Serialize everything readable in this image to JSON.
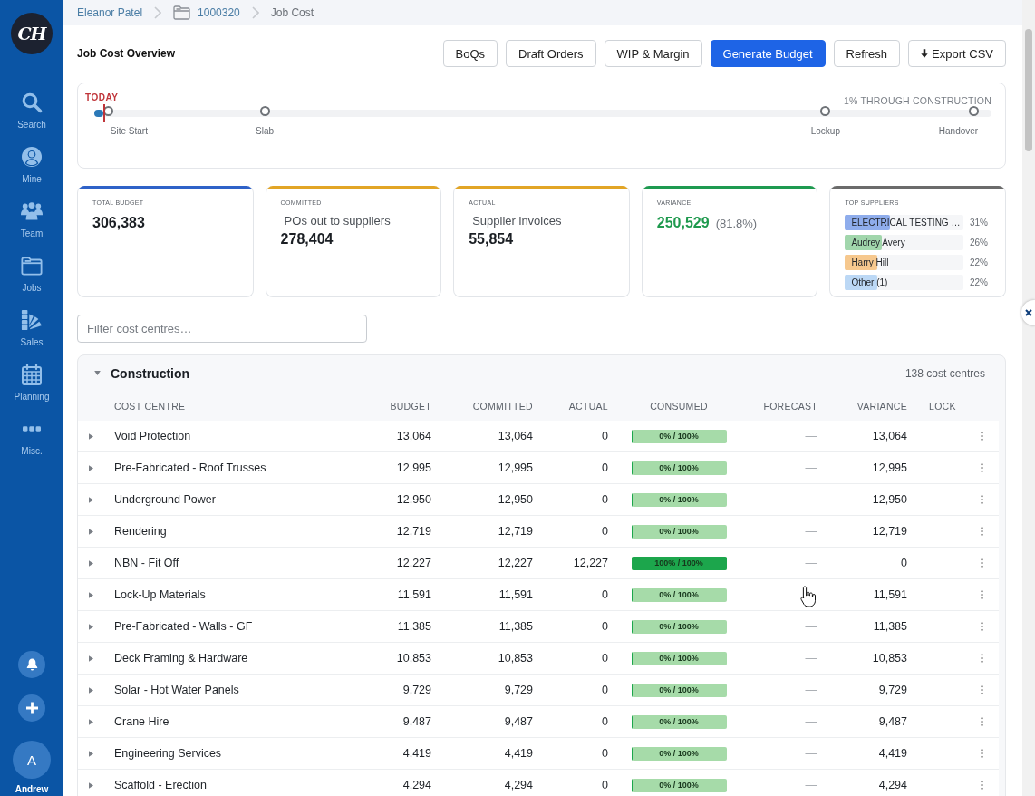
{
  "sidebar": {
    "logo": "CH",
    "nav": [
      {
        "label": "Search"
      },
      {
        "label": "Mine"
      },
      {
        "label": "Team"
      },
      {
        "label": "Jobs"
      },
      {
        "label": "Sales"
      },
      {
        "label": "Planning"
      },
      {
        "label": "Misc."
      }
    ],
    "user": {
      "initial": "A",
      "name": "Andrew"
    }
  },
  "breadcrumb": [
    {
      "label": "Eleanor Patel",
      "kind": "link"
    },
    {
      "label": "1000320",
      "kind": "job"
    },
    {
      "label": "Job Cost",
      "kind": "current"
    }
  ],
  "header": {
    "title": "Job Cost Overview",
    "buttons": [
      {
        "label": "BoQs",
        "kind": "plain"
      },
      {
        "label": "Draft Orders",
        "kind": "plain"
      },
      {
        "label": "WIP & Margin",
        "kind": "plain"
      },
      {
        "label": "Generate Budget",
        "kind": "primary"
      },
      {
        "label": "Refresh",
        "kind": "plain"
      },
      {
        "label": "Export CSV",
        "kind": "download"
      }
    ]
  },
  "timeline": {
    "today_label": "TODAY",
    "progress_label": "1% THROUGH CONSTRUCTION",
    "level": 0.01,
    "milestones": [
      {
        "label": "Site Start"
      },
      {
        "label": "Slab"
      },
      {
        "label": "Lockup"
      },
      {
        "label": "Handover"
      }
    ]
  },
  "cards": [
    {
      "kind": "metric",
      "label": "TOTAL BUDGET",
      "value": "306,383",
      "color": "#2f62c8"
    },
    {
      "kind": "metric",
      "label": "COMMITTED",
      "caption": "POs out to suppliers",
      "value": "278,404",
      "color": "#e2a526"
    },
    {
      "kind": "metric",
      "label": "ACTUAL",
      "caption": "Supplier invoices",
      "value": "55,854",
      "color": "#e2a526"
    },
    {
      "kind": "variance",
      "label": "VARIANCE",
      "value": "250,529",
      "note": "(81.8%)",
      "color": "#1e9a50"
    },
    {
      "kind": "suppliers",
      "label": "TOP SUPPLIERS",
      "color": "#6b6b6b",
      "suppliers": [
        {
          "name": "ELECTRICAL TESTING …",
          "share": "31%",
          "level": 0.38,
          "color": "#8fadec"
        },
        {
          "name": "Audrey Avery",
          "share": "26%",
          "level": 0.31,
          "color": "#a1d6ac"
        },
        {
          "name": "Harry Hill",
          "share": "22%",
          "level": 0.27,
          "color": "#f6c88e"
        },
        {
          "name": "Other (1)",
          "share": "22%",
          "level": 0.27,
          "color": "#bcd8f5"
        }
      ]
    }
  ],
  "filter": {
    "placeholder": "Filter cost centres…"
  },
  "group": {
    "title": "Construction",
    "expanded": true,
    "count": "138 cost centres",
    "columns": [
      "COST CENTRE",
      "BUDGET",
      "COMMITTED",
      "ACTUAL",
      "CONSUMED",
      "FORECAST",
      "VARIANCE",
      "LOCK"
    ],
    "rows": [
      {
        "name": "Void Protection",
        "expanded": false,
        "budget": "13,064",
        "committed": "13,064",
        "actual": "0",
        "consumed": "0% / 100%",
        "level": 0,
        "forecast": "—",
        "variance": "13,064"
      },
      {
        "name": "Pre-Fabricated - Roof Trusses",
        "expanded": false,
        "budget": "12,995",
        "committed": "12,995",
        "actual": "0",
        "consumed": "0% / 100%",
        "level": 0,
        "forecast": "—",
        "variance": "12,995"
      },
      {
        "name": "Underground Power",
        "expanded": false,
        "budget": "12,950",
        "committed": "12,950",
        "actual": "0",
        "consumed": "0% / 100%",
        "level": 0,
        "forecast": "—",
        "variance": "12,950"
      },
      {
        "name": "Rendering",
        "expanded": false,
        "budget": "12,719",
        "committed": "12,719",
        "actual": "0",
        "consumed": "0% / 100%",
        "level": 0,
        "forecast": "—",
        "variance": "12,719"
      },
      {
        "name": "NBN - Fit Off",
        "expanded": false,
        "budget": "12,227",
        "committed": "12,227",
        "actual": "12,227",
        "consumed": "100% / 100%",
        "level": 1,
        "forecast": "—",
        "variance": "0"
      },
      {
        "name": "Lock-Up Materials",
        "expanded": false,
        "budget": "11,591",
        "committed": "11,591",
        "actual": "0",
        "consumed": "0% / 100%",
        "level": 0,
        "variance": "11,591"
      },
      {
        "name": "Pre-Fabricated - Walls - GF",
        "expanded": false,
        "budget": "11,385",
        "committed": "11,385",
        "actual": "0",
        "consumed": "0% / 100%",
        "level": 0,
        "forecast": "—",
        "variance": "11,385"
      },
      {
        "name": "Deck Framing & Hardware",
        "expanded": false,
        "budget": "10,853",
        "committed": "10,853",
        "actual": "0",
        "consumed": "0% / 100%",
        "level": 0,
        "forecast": "—",
        "variance": "10,853"
      },
      {
        "name": "Solar - Hot Water Panels",
        "expanded": false,
        "budget": "9,729",
        "committed": "9,729",
        "actual": "0",
        "consumed": "0% / 100%",
        "level": 0,
        "forecast": "—",
        "variance": "9,729"
      },
      {
        "name": "Crane Hire",
        "expanded": false,
        "budget": "9,487",
        "committed": "9,487",
        "actual": "0",
        "consumed": "0% / 100%",
        "level": 0,
        "forecast": "—",
        "variance": "9,487"
      },
      {
        "name": "Engineering Services",
        "expanded": false,
        "budget": "4,419",
        "committed": "4,419",
        "actual": "0",
        "consumed": "0% / 100%",
        "level": 0,
        "forecast": "—",
        "variance": "4,419"
      },
      {
        "name": "Scaffold - Erection",
        "expanded": false,
        "budget": "4,294",
        "committed": "4,294",
        "actual": "0",
        "consumed": "0% / 100%",
        "level": 0,
        "forecast": "—",
        "variance": "4,294"
      }
    ]
  }
}
